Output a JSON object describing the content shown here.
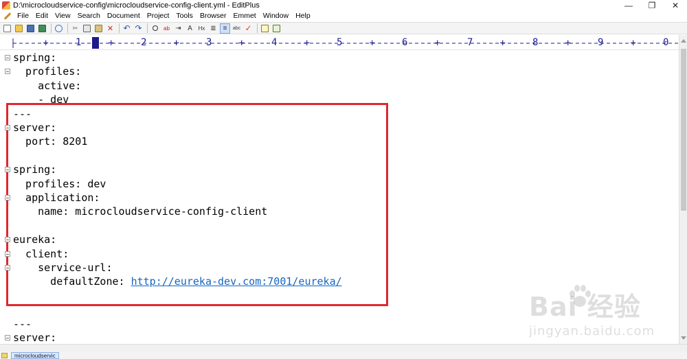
{
  "window": {
    "title": "D:\\microcloudservice-config\\microcloudservice-config-client.yml - EditPlus",
    "minimize_glyph": "—",
    "restore_glyph": "❐",
    "close_glyph": "✕"
  },
  "menu": [
    "File",
    "Edit",
    "View",
    "Search",
    "Document",
    "Project",
    "Tools",
    "Browser",
    "Emmet",
    "Window",
    "Help"
  ],
  "toolbar_icons": [
    "new-file-icon",
    "open-folder-icon",
    "save-icon",
    "save-all-icon",
    "browser-preview-icon",
    "cut-icon",
    "copy-icon",
    "paste-icon",
    "delete-icon",
    "undo-icon",
    "redo-icon",
    "find-icon",
    "replace-icon",
    "find-next-icon",
    "font-size-icon",
    "hex-icon",
    "word-wrap-icon",
    "line-number-icon",
    "column-select-icon",
    "spell-check-icon",
    "screen-toggle-icon",
    "output-window-icon"
  ],
  "ruler": {
    "numbers": [
      "1",
      "2",
      "3",
      "4",
      "5",
      "6",
      "7",
      "8",
      "9",
      "0"
    ]
  },
  "editor": {
    "lines": [
      {
        "text": "spring:",
        "fold": true
      },
      {
        "text": "  profiles:",
        "fold": true
      },
      {
        "text": "    active:",
        "fold": false
      },
      {
        "text": "    - dev",
        "fold": false
      },
      {
        "text": "---",
        "fold": false
      },
      {
        "text": "server:",
        "fold": true
      },
      {
        "text": "  port: 8201",
        "fold": false
      },
      {
        "text": "",
        "fold": false
      },
      {
        "text": "spring:",
        "fold": true
      },
      {
        "text": "  profiles: dev",
        "fold": false
      },
      {
        "text": "  application:",
        "fold": true
      },
      {
        "text": "    name: microcloudservice-config-client",
        "fold": false
      },
      {
        "text": "",
        "fold": false
      },
      {
        "text": "eureka:",
        "fold": true
      },
      {
        "text": "  client:",
        "fold": true
      },
      {
        "text": "    service-url:",
        "fold": true
      },
      {
        "text": "      defaultZone: ",
        "fold": false,
        "link": "http://eureka-dev.com:7001/eureka/"
      },
      {
        "text": "",
        "fold": false
      },
      {
        "text": "",
        "fold": false
      },
      {
        "text": "---",
        "fold": false
      },
      {
        "text": "server:",
        "fold": true
      }
    ]
  },
  "tab": {
    "label": "microcloudservic"
  },
  "watermark": {
    "logo_text": "Bai  经验",
    "url_text": "jingyan.baidu.com"
  },
  "colors": {
    "highlight_border": "#e0262d",
    "link": "#1565c0",
    "ruler_text": "#1b1b8f"
  }
}
